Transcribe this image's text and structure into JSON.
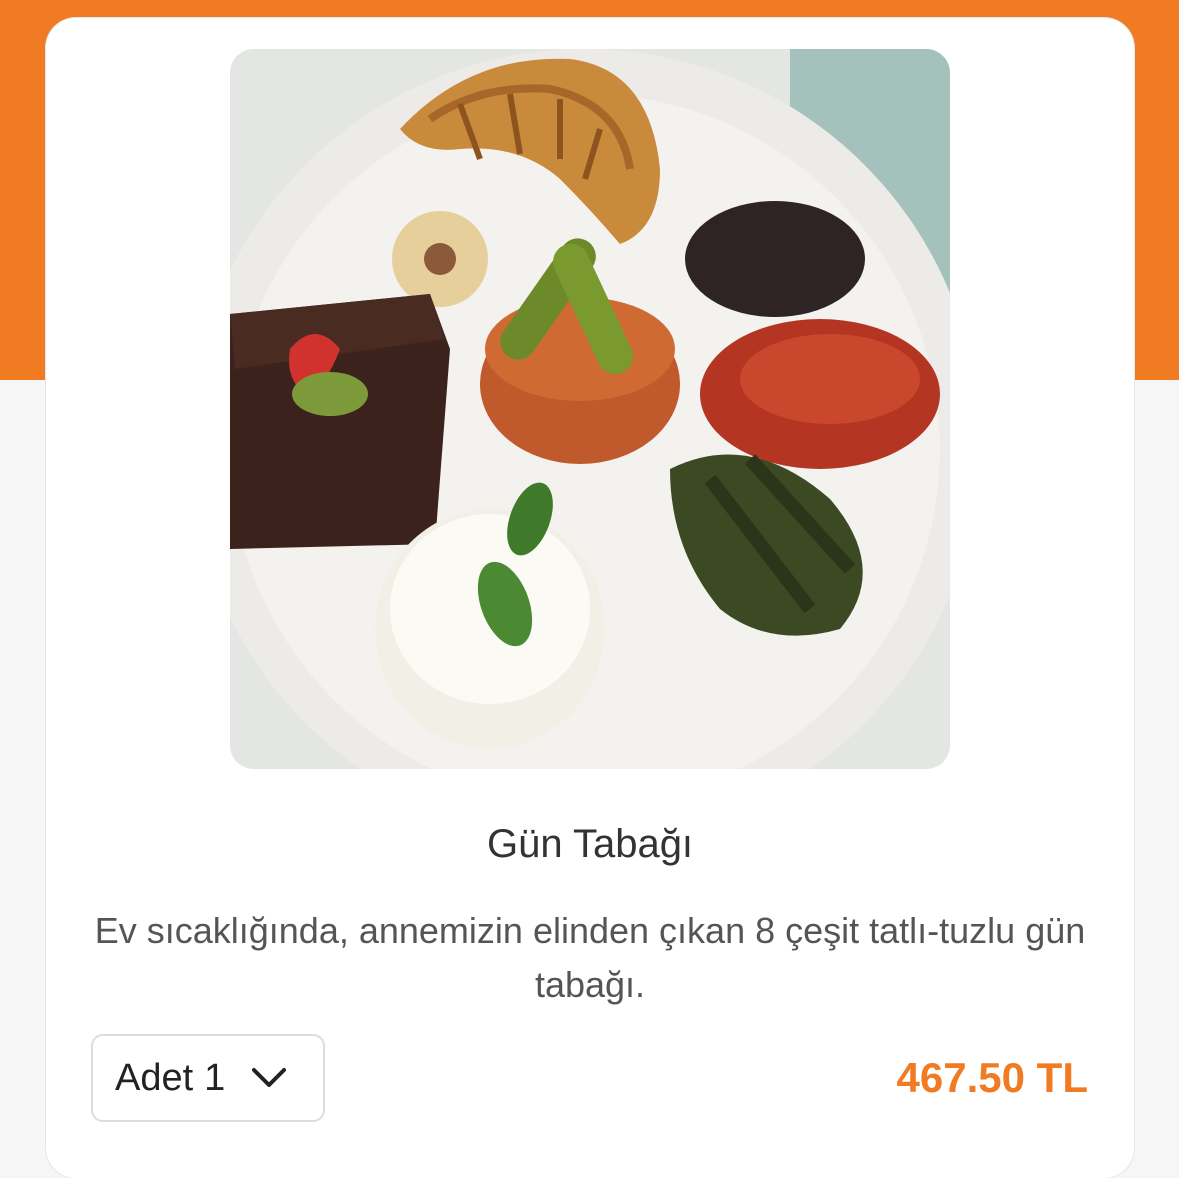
{
  "product": {
    "title": "Gün Tabağı",
    "description": "Ev sıcaklığında, annemizin elinden çıkan 8 çeşit tatlı-tuzlu gün tabağı.",
    "image_alt": "Gün Tabağı"
  },
  "quantity": {
    "label": "Adet",
    "value": "1",
    "icon": "chevron-down-icon"
  },
  "price": "467.50 TL",
  "colors": {
    "accent": "#f07b22",
    "price": "#f07b22",
    "card": "#ffffff",
    "background": "#f6f6f6"
  }
}
